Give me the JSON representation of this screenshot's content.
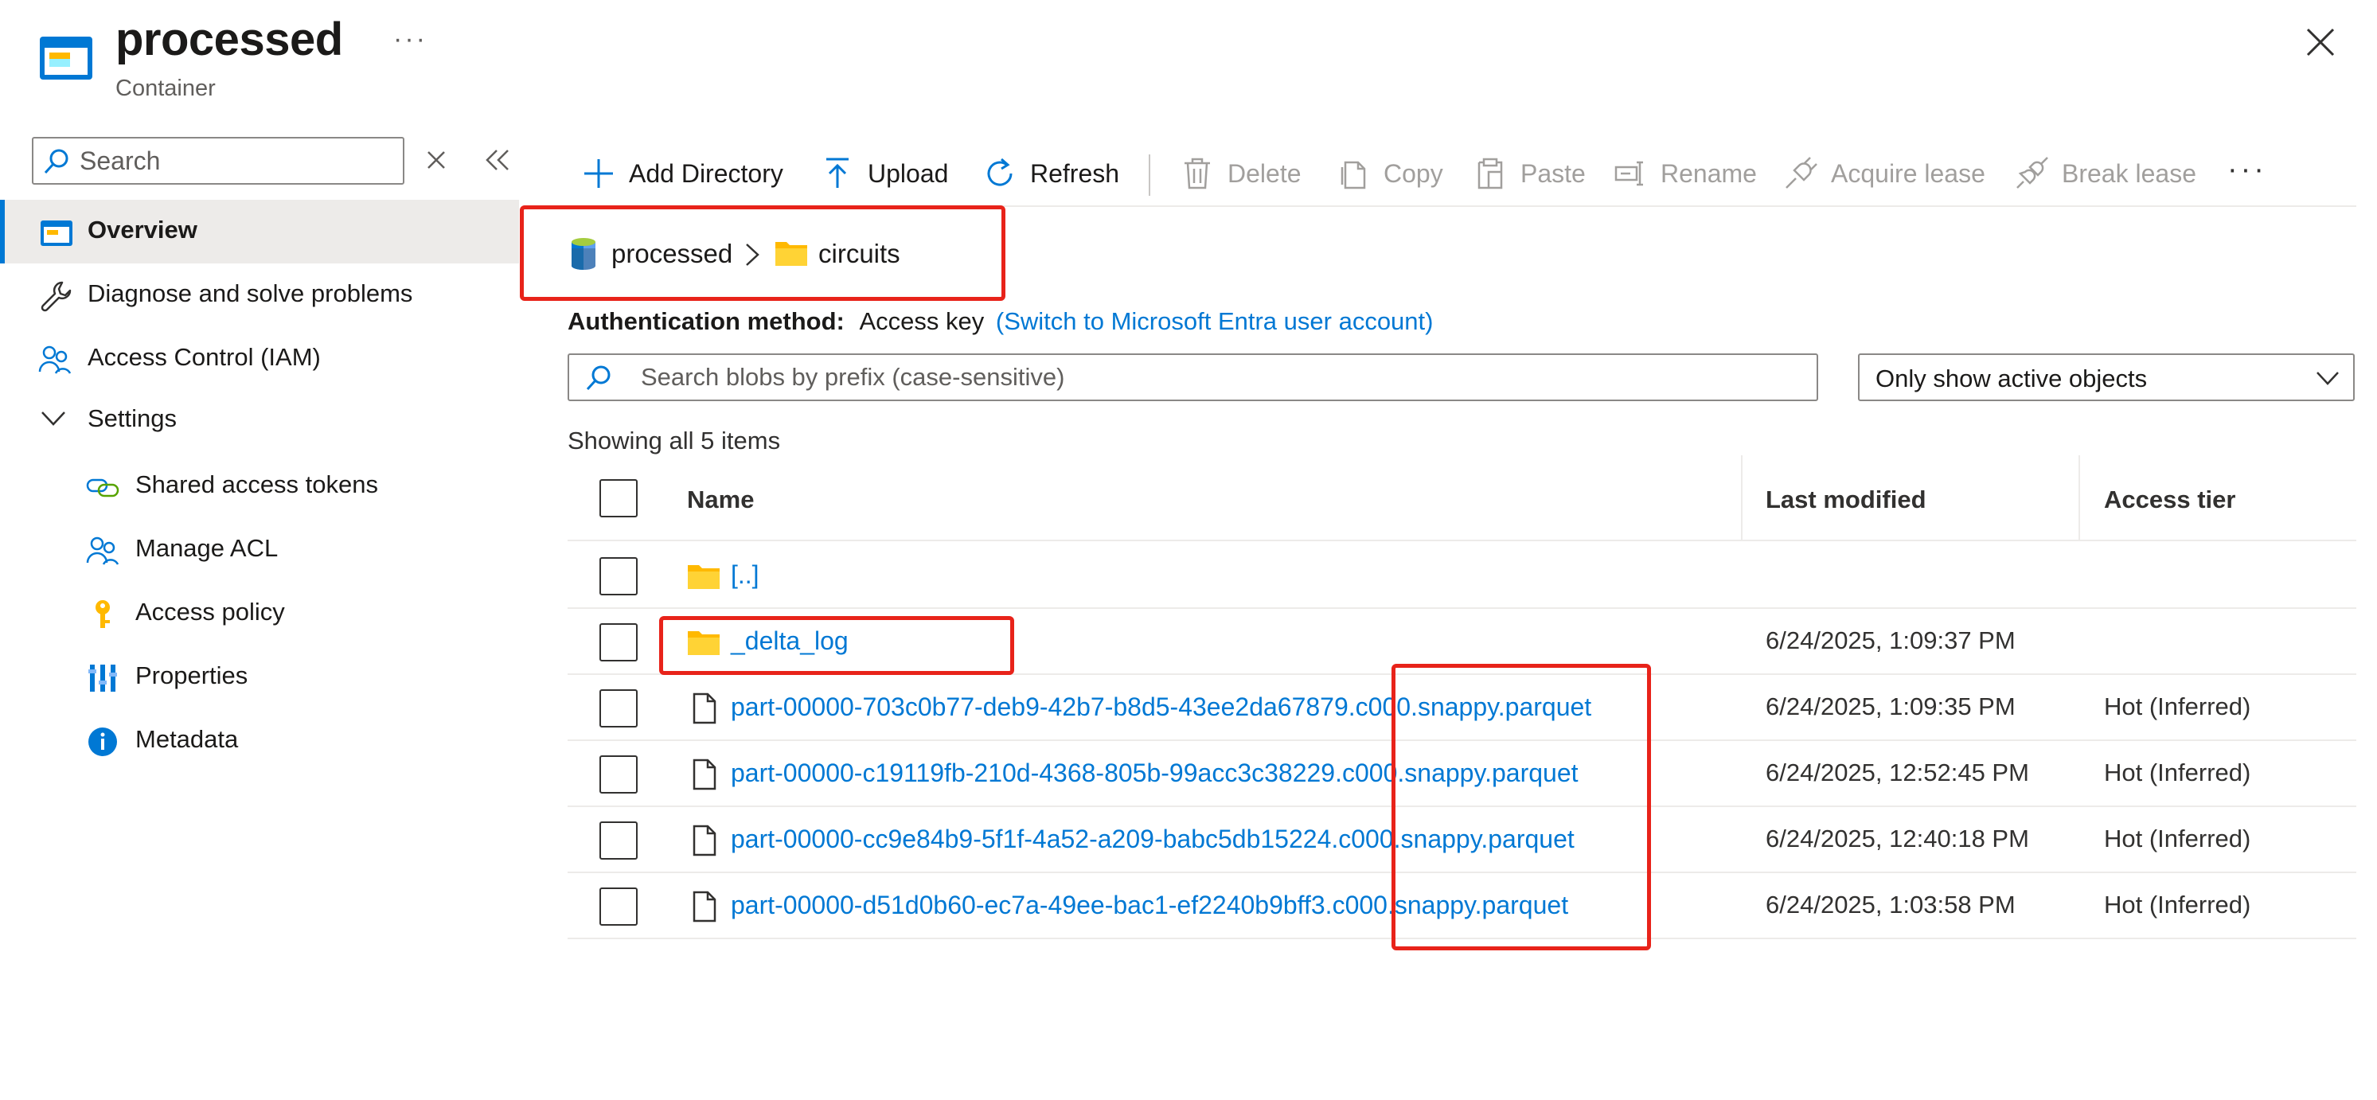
{
  "header": {
    "title": "processed",
    "subtitle": "Container",
    "more": "···"
  },
  "nav": {
    "search_placeholder": "Search",
    "items": [
      {
        "label": "Overview"
      },
      {
        "label": "Diagnose and solve problems"
      },
      {
        "label": "Access Control (IAM)"
      },
      {
        "label": "Settings"
      },
      {
        "label": "Shared access tokens"
      },
      {
        "label": "Manage ACL"
      },
      {
        "label": "Access policy"
      },
      {
        "label": "Properties"
      },
      {
        "label": "Metadata"
      }
    ]
  },
  "toolbar": {
    "add_directory": "Add Directory",
    "upload": "Upload",
    "refresh": "Refresh",
    "delete": "Delete",
    "copy": "Copy",
    "paste": "Paste",
    "rename": "Rename",
    "acquire_lease": "Acquire lease",
    "break_lease": "Break lease",
    "more": "···"
  },
  "breadcrumb": {
    "container": "processed",
    "folder": "circuits"
  },
  "auth": {
    "label": "Authentication method:",
    "value": "Access key",
    "switch_link": "(Switch to Microsoft Entra user account)"
  },
  "blob_search": {
    "placeholder": "Search blobs by prefix (case-sensitive)"
  },
  "filter": {
    "selected": "Only show active objects"
  },
  "list": {
    "count_text": "Showing all 5 items",
    "columns": {
      "name": "Name",
      "last_modified": "Last modified",
      "access_tier": "Access tier"
    },
    "rows": [
      {
        "name": "[..]",
        "last_modified": "",
        "access_tier": "",
        "kind": "folder-icon"
      },
      {
        "name": "_delta_log",
        "last_modified": "6/24/2025, 1:09:37 PM",
        "access_tier": "",
        "kind": "folder-icon"
      },
      {
        "name": "part-00000-703c0b77-deb9-42b7-b8d5-43ee2da67879.c000.snappy.parquet",
        "last_modified": "6/24/2025, 1:09:35 PM",
        "access_tier": "Hot (Inferred)",
        "kind": "file-icon"
      },
      {
        "name": "part-00000-c19119fb-210d-4368-805b-99acc3c38229.c000.snappy.parquet",
        "last_modified": "6/24/2025, 12:52:45 PM",
        "access_tier": "Hot (Inferred)",
        "kind": "file-icon"
      },
      {
        "name": "part-00000-cc9e84b9-5f1f-4a52-a209-babc5db15224.c000.snappy.parquet",
        "last_modified": "6/24/2025, 12:40:18 PM",
        "access_tier": "Hot (Inferred)",
        "kind": "file-icon"
      },
      {
        "name": "part-00000-d51d0b60-ec7a-49ee-bac1-ef2240b9bff3.c000.snappy.parquet",
        "last_modified": "6/24/2025, 1:03:58 PM",
        "access_tier": "Hot (Inferred)",
        "kind": "file-icon"
      }
    ]
  },
  "colors": {
    "accent": "#0078d4",
    "annotation": "#e8231a",
    "folder": "#ffb900"
  }
}
